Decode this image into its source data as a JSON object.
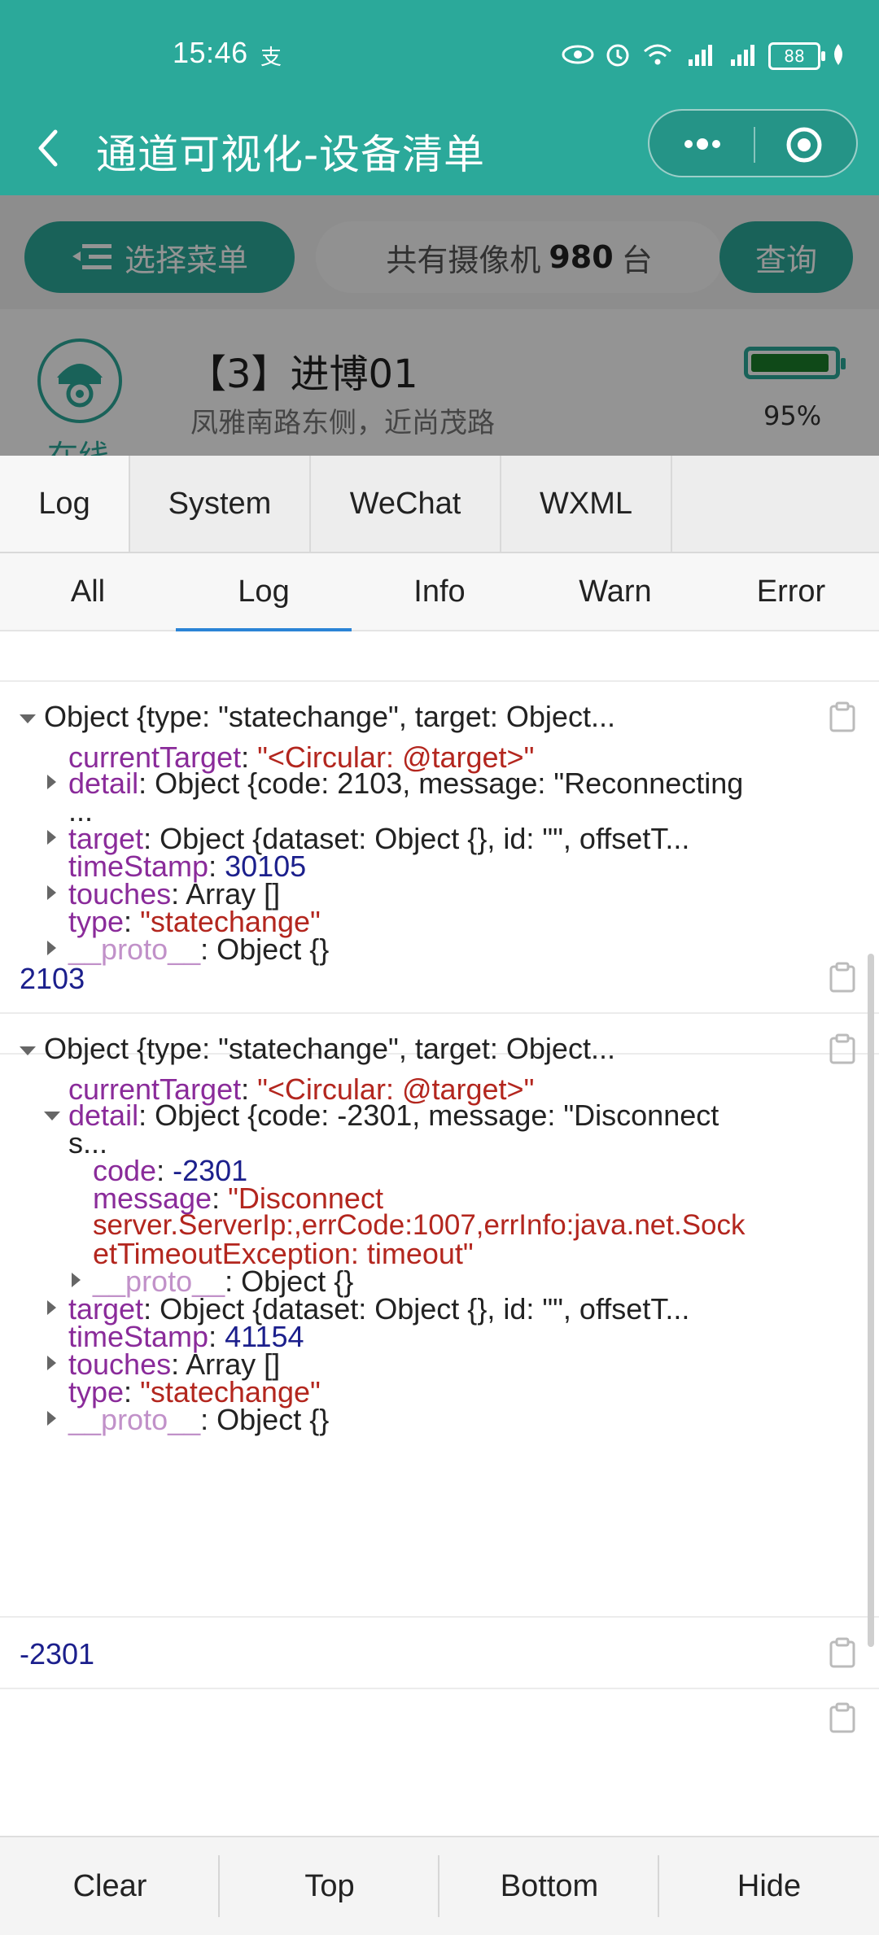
{
  "status_bar": {
    "time": "15:46",
    "glyph": "支",
    "battery": "88"
  },
  "nav": {
    "title": "通道可视化-设备清单"
  },
  "page": {
    "menu_label": "选择菜单",
    "count_prefix": "共有摄像机",
    "count_value": "980",
    "count_suffix": "台",
    "query_label": "查询",
    "device": {
      "name": "【3】进博01",
      "address": "凤雅南路东侧，近尚茂路",
      "status": "在线",
      "battery_percent": "95%",
      "battery_level": 0.95
    }
  },
  "vconsole": {
    "main_tabs": [
      "Log",
      "System",
      "WeChat",
      "WXML"
    ],
    "sub_tabs": [
      "All",
      "Log",
      "Info",
      "Warn",
      "Error"
    ],
    "active_sub_tab": "Log",
    "entries": {
      "e1": {
        "header": "Object {type: \"statechange\", target: Object...",
        "currentTarget_key": "currentTarget",
        "currentTarget_val": "\"<Circular: @target>\"",
        "detail_key": "detail",
        "detail_val_l1": "Object {code: 2103, message: \"Reconnecting",
        "detail_val_l2": "...",
        "target_key": "target",
        "target_val": "Object {dataset: Object {}, id: \"\", offsetT...",
        "timeStamp_key": "timeStamp",
        "timeStamp_val": "30105",
        "touches_key": "touches",
        "touches_val": "Array []",
        "type_key": "type",
        "type_val": "\"statechange\"",
        "proto_key": "__proto__",
        "proto_val": "Object {}"
      },
      "e2": {
        "value": "2103"
      },
      "e3": {
        "header": "Object {type: \"statechange\", target: Object...",
        "currentTarget_key": "currentTarget",
        "currentTarget_val": "\"<Circular: @target>\"",
        "detail_key": "detail",
        "detail_val_l1": "Object {code: -2301, message: \"Disconnect",
        "detail_val_l2": "s...",
        "code_key": "code",
        "code_val": "-2301",
        "message_key": "message",
        "message_l1": "\"Disconnect",
        "message_l2": "server.ServerIp:,errCode:1007,errInfo:java.net.Sock",
        "message_l3": "etTimeoutException: timeout\"",
        "inner_proto_key": "__proto__",
        "inner_proto_val": "Object {}",
        "target_key": "target",
        "target_val": "Object {dataset: Object {}, id: \"\", offsetT...",
        "timeStamp_key": "timeStamp",
        "timeStamp_val": "41154",
        "touches_key": "touches",
        "touches_val": "Array []",
        "type_key": "type",
        "type_val": "\"statechange\"",
        "proto_key": "__proto__",
        "proto_val": "Object {}"
      },
      "e4": {
        "value": "-2301"
      }
    },
    "bottom_buttons": [
      "Clear",
      "Top",
      "Bottom",
      "Hide"
    ]
  },
  "colors": {
    "brand": "#2ba99a",
    "key": "#8a2b9a",
    "string": "#b3261e",
    "number": "#1b1f8c",
    "active_tab_indicator": "#2b84d6"
  }
}
